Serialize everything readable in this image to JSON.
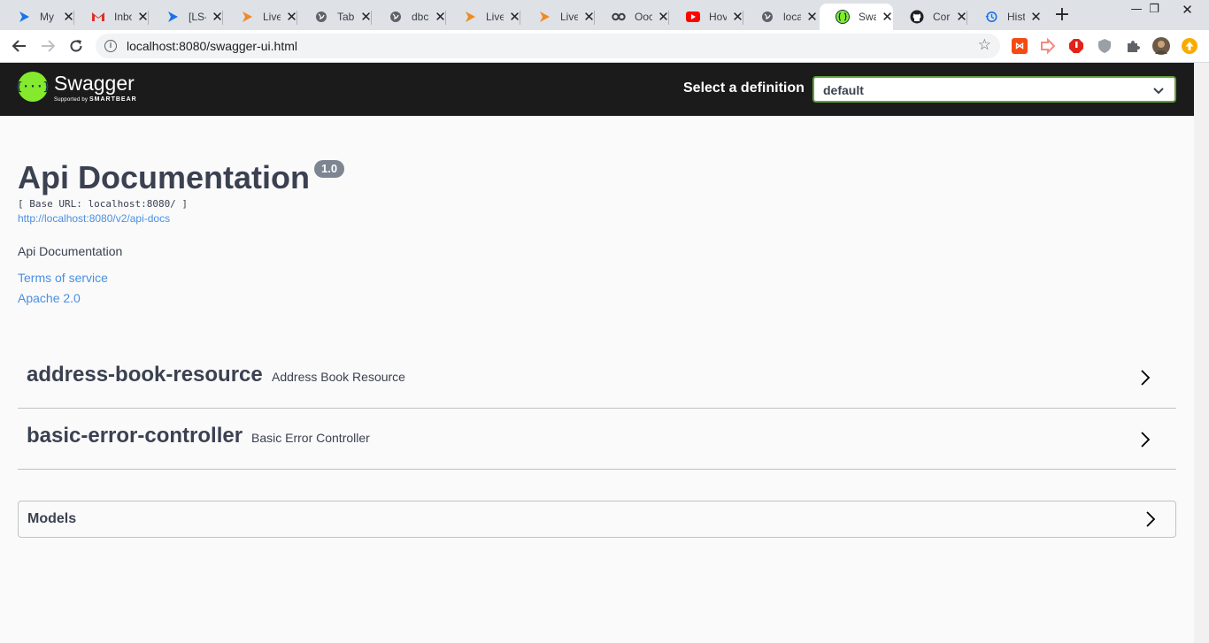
{
  "browser": {
    "tabs": [
      {
        "label": "My",
        "icon": "blue-arrow-icon",
        "color": "#1a73e8"
      },
      {
        "label": "Inbo",
        "icon": "gmail-icon",
        "color": "#d93025"
      },
      {
        "label": "[LS-",
        "icon": "blue-arrow-icon",
        "color": "#1a73e8"
      },
      {
        "label": "Live",
        "icon": "orange-arrow-icon",
        "color": "#f08a24"
      },
      {
        "label": "Tab",
        "icon": "globe-icon",
        "color": "#5f6368"
      },
      {
        "label": "dbc",
        "icon": "globe-icon",
        "color": "#5f6368"
      },
      {
        "label": "Live",
        "icon": "orange-arrow-icon",
        "color": "#f08a24"
      },
      {
        "label": "Live",
        "icon": "orange-arrow-icon",
        "color": "#f08a24"
      },
      {
        "label": "Ooc",
        "icon": "infinity-icon",
        "color": "#3c4043"
      },
      {
        "label": "Hov",
        "icon": "youtube-icon",
        "color": "#ff0000"
      },
      {
        "label": "loca",
        "icon": "globe-icon",
        "color": "#5f6368"
      },
      {
        "label": "Swa",
        "icon": "swagger-icon",
        "color": "#85ea2d"
      },
      {
        "label": "Cor",
        "icon": "github-icon",
        "color": "#202124"
      },
      {
        "label": "Hist",
        "icon": "history-icon",
        "color": "#1a73e8"
      }
    ],
    "active_tab_index": 11,
    "new_tab": "+",
    "address": "localhost:8080/swagger-ui.html"
  },
  "swagger": {
    "logo_word": "Swagger",
    "logo_sub_prefix": "Supported by",
    "logo_sub_brand": "SMARTBEAR",
    "definition_label": "Select a definition",
    "definition_value": "default",
    "accent_color": "#85ea2d"
  },
  "info": {
    "title": "Api Documentation",
    "version": "1.0",
    "base_url": "[ Base URL: localhost:8080/ ]",
    "api_docs_link": "http://localhost:8080/v2/api-docs",
    "description": "Api Documentation",
    "terms": "Terms of service",
    "license": "Apache 2.0"
  },
  "tags": [
    {
      "name": "address-book-resource",
      "description": "Address Book Resource"
    },
    {
      "name": "basic-error-controller",
      "description": "Basic Error Controller"
    }
  ],
  "models": {
    "label": "Models"
  }
}
